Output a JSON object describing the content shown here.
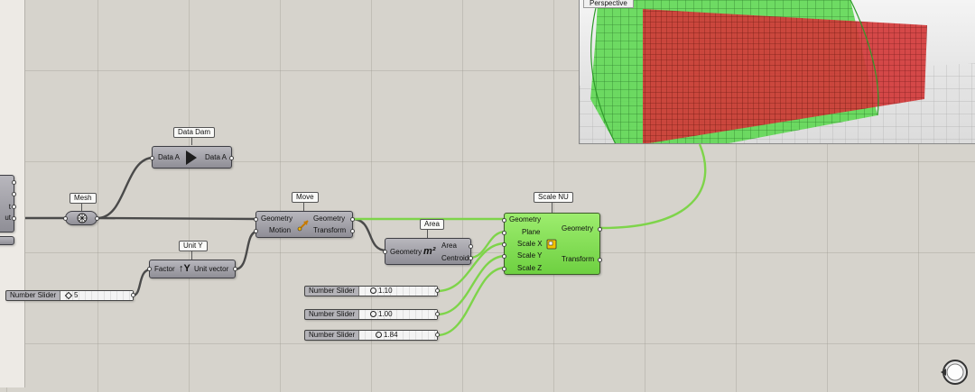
{
  "viewport": {
    "label": "Perspective"
  },
  "left_component": {
    "outputs": [
      "t",
      "ut"
    ]
  },
  "components": {
    "data_dam": {
      "tag": "Data Dam",
      "input": "Data A",
      "output": "Data A"
    },
    "mesh": {
      "tag": "Mesh"
    },
    "move": {
      "tag": "Move",
      "inputs": [
        "Geometry",
        "Motion"
      ],
      "outputs": [
        "Geometry",
        "Transform"
      ]
    },
    "unit_y": {
      "tag": "Unit Y",
      "input": "Factor",
      "icon_text": "Y",
      "output": "Unit vector"
    },
    "area": {
      "tag": "Area",
      "input": "Geometry",
      "icon_text": "m²",
      "outputs": [
        "Area",
        "Centroid"
      ]
    },
    "scale_nu": {
      "tag": "Scale NU",
      "inputs": [
        "Geometry",
        "Plane",
        "Scale X",
        "Scale Y",
        "Scale Z"
      ],
      "outputs": [
        "Geometry",
        "Transform"
      ]
    }
  },
  "sliders": [
    {
      "label": "Number Slider",
      "value": "5"
    },
    {
      "label": "Number Slider",
      "value": "1.10"
    },
    {
      "label": "Number Slider",
      "value": "1.00"
    },
    {
      "label": "Number Slider",
      "value": "1.84"
    }
  ],
  "colors": {
    "canvas": "#d6d3cc",
    "wire": "#4a4a4a",
    "active_wire": "#7ed44a",
    "active_component": "#86e055",
    "box_red": "#d33a3a",
    "mesh_green": "#4fd14a"
  }
}
